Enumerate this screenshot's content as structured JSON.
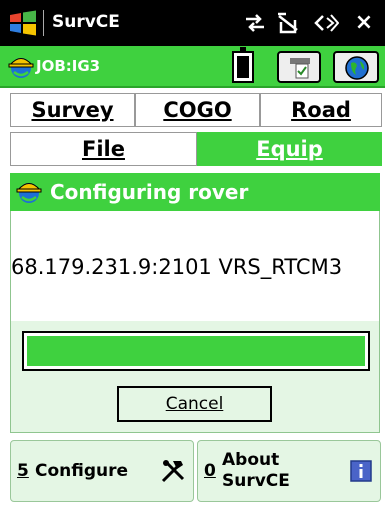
{
  "titlebar": {
    "title": "SurvCE",
    "icons": [
      "windows-flag-icon",
      "connectivity-icon",
      "signal-off-icon",
      "volume-icon",
      "close-icon"
    ],
    "close_glyph": "×"
  },
  "jobbar": {
    "job_label": "JOB:IG3",
    "icons": [
      "battery-icon",
      "instrument-icon",
      "globe-icon"
    ]
  },
  "tabs": {
    "row1": [
      {
        "label": "Survey"
      },
      {
        "label": "COGO"
      },
      {
        "label": "Road"
      }
    ],
    "row2": [
      {
        "label": "File"
      },
      {
        "label": "Equip",
        "active": true
      }
    ]
  },
  "dialog": {
    "title": "Configuring rover",
    "message": "68.179.231.9:2101 VRS_RTCM3",
    "progress": 1.0,
    "cancel_label": "Cancel"
  },
  "bottom": {
    "configure": {
      "number": "5",
      "label": "Configure"
    },
    "about": {
      "number": "0",
      "label_line1": "About",
      "label_line2": "SurvCE"
    }
  },
  "colors": {
    "accent_green": "#3fd13f",
    "panel_green": "#e4f6e4",
    "titlebar": "#000000"
  }
}
